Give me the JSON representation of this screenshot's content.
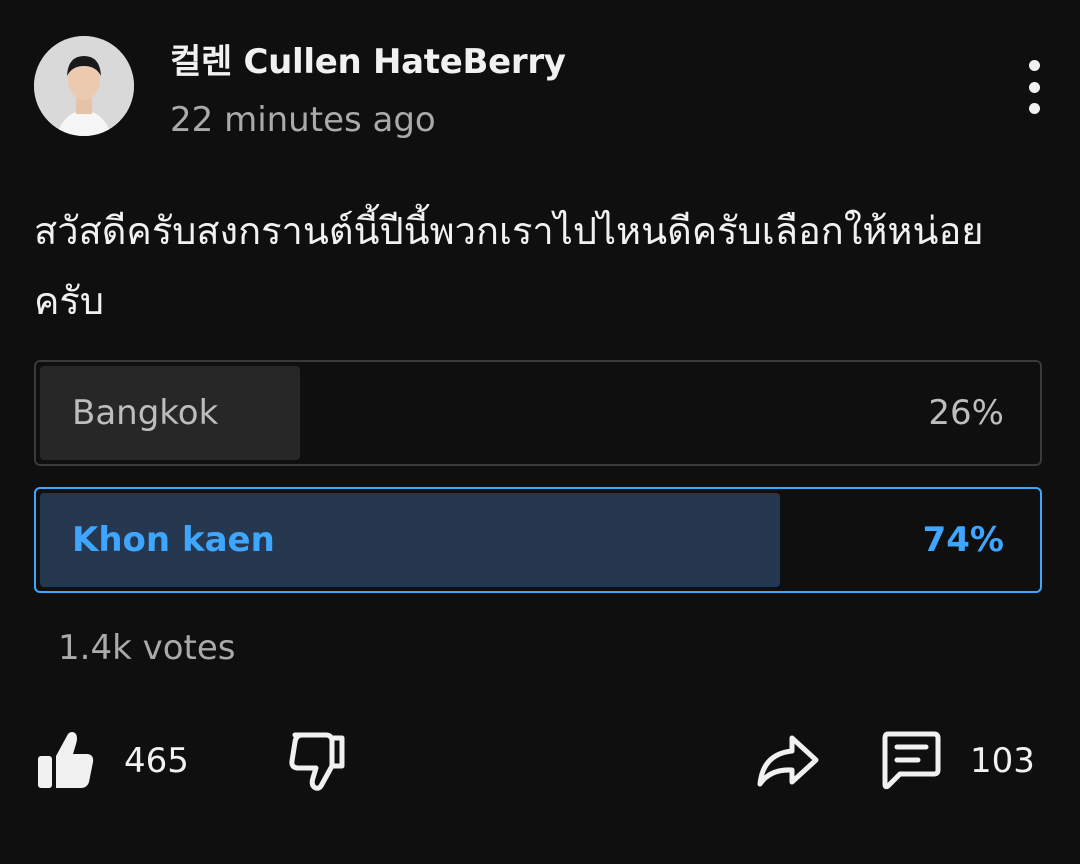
{
  "post": {
    "author": "컬렌 Cullen HateBerry",
    "time": "22 minutes ago",
    "text": "สวัสดีครับสงกรานต์นี้ปีนี้พวกเราไปไหนดีครับเลือกให้หน่อยครับ"
  },
  "poll": {
    "options": [
      {
        "label": "Bangkok",
        "percent_text": "26%",
        "percent": 26,
        "selected": false
      },
      {
        "label": "Khon kaen",
        "percent_text": "74%",
        "percent": 74,
        "selected": true
      }
    ],
    "votes": "1.4k votes"
  },
  "actions": {
    "likes": "465",
    "comments": "103",
    "icons": [
      "thumbs-up-icon",
      "thumbs-down-icon",
      "share-icon",
      "comment-icon",
      "more-vert-icon"
    ]
  },
  "colors": {
    "background": "#0f0f0f",
    "accent": "#3ea6ff",
    "selected_fill": "#263850"
  }
}
